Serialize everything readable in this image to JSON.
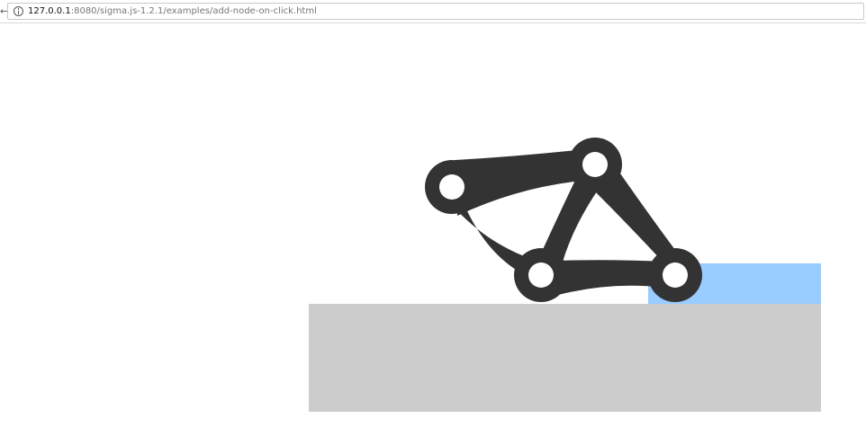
{
  "browser": {
    "left_edge_glyph": "←",
    "address_bar": {
      "host": "127.0.0.1",
      "rest": ":8080/sigma.js-1.2.1/examples/add-node-on-click.html"
    }
  },
  "colors": {
    "graph": "#333333",
    "floor": "#cccccc",
    "highlight": "#99ccff"
  },
  "graph_icon": "graph-network-icon"
}
